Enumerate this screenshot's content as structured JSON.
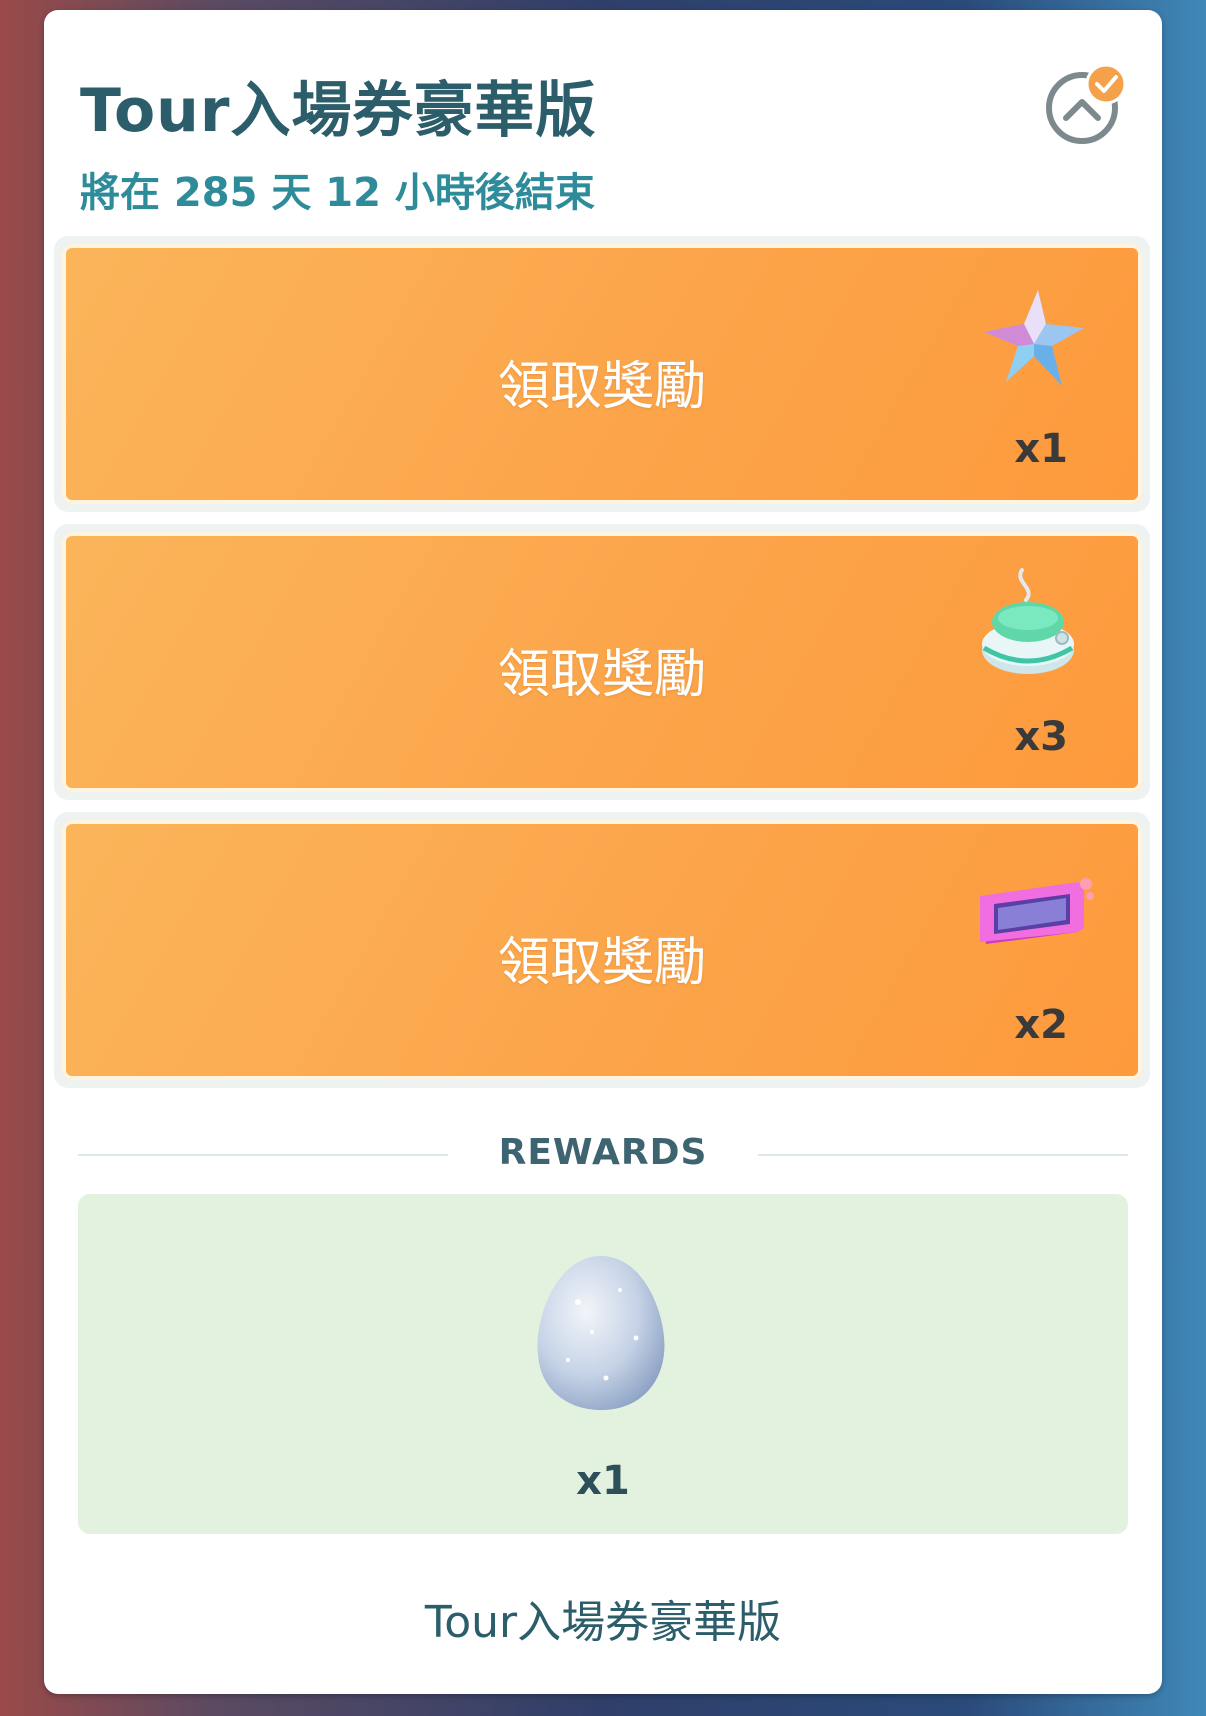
{
  "header": {
    "title": "Tour入場券豪華版",
    "subtitle": "將在 285 天 12 小時後結束"
  },
  "tasks": [
    {
      "label": "領取獎勵",
      "count": "x1",
      "icon": "star-piece-icon"
    },
    {
      "label": "領取獎勵",
      "count": "x3",
      "icon": "incense-icon"
    },
    {
      "label": "領取獎勵",
      "count": "x2",
      "icon": "premium-raid-pass-icon"
    }
  ],
  "rewards": {
    "heading": "REWARDS",
    "item_icon": "egg-icon",
    "item_count": "x1"
  },
  "footer": {
    "title": "Tour入場券豪華版"
  },
  "colors": {
    "accent_orange": "#fca44a",
    "title_teal": "#2c5d6a",
    "subtitle_teal": "#2e8c9a",
    "rewards_bg": "#e3f1df"
  }
}
